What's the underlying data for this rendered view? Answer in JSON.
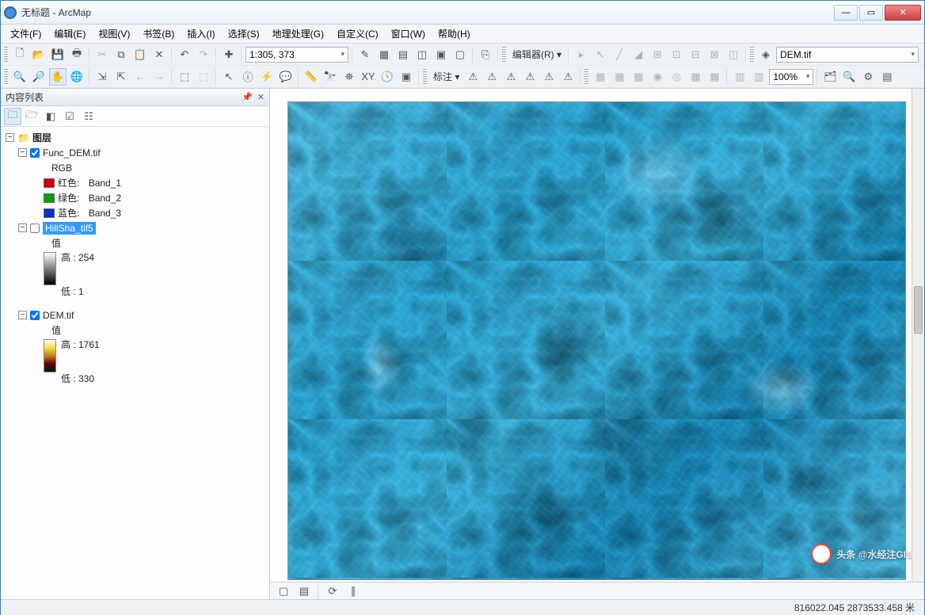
{
  "window": {
    "title": "无标题 - ArcMap"
  },
  "menu": [
    "文件(F)",
    "编辑(E)",
    "视图(V)",
    "书签(B)",
    "插入(I)",
    "选择(S)",
    "地理处理(G)",
    "自定义(C)",
    "窗口(W)",
    "帮助(H)"
  ],
  "scale": "1:305, 373",
  "editor_label": "编辑器(R)",
  "annotate_label": "标注",
  "layer_combo": "DEM.tif",
  "percent": "100%",
  "toc": {
    "title": "内容列表",
    "root": "图层",
    "layers": [
      {
        "name": "Func_DEM.tif",
        "checked": true,
        "type_label": "RGB",
        "bands": [
          {
            "color": "#d40000",
            "label": "红色:",
            "band": "Band_1"
          },
          {
            "color": "#00a000",
            "label": "绿色:",
            "band": "Band_2"
          },
          {
            "color": "#0030d0",
            "label": "蓝色:",
            "band": "Band_3"
          }
        ]
      },
      {
        "name": "HillSha_tif5",
        "checked": false,
        "selected": true,
        "value_label": "值",
        "high": "高 : 254",
        "low": "低 : 1",
        "ramp": [
          "#ffffff",
          "#000000"
        ]
      },
      {
        "name": "DEM.tif",
        "checked": true,
        "value_label": "值",
        "high": "高 : 1761",
        "low": "低 : 330",
        "ramp": [
          "#ffffff",
          "#f0e040",
          "#c08020",
          "#600000",
          "#002000"
        ]
      }
    ]
  },
  "status": {
    "coords": "816022.045  2873533.458 米"
  },
  "watermark": "头条 @水经注GIS"
}
